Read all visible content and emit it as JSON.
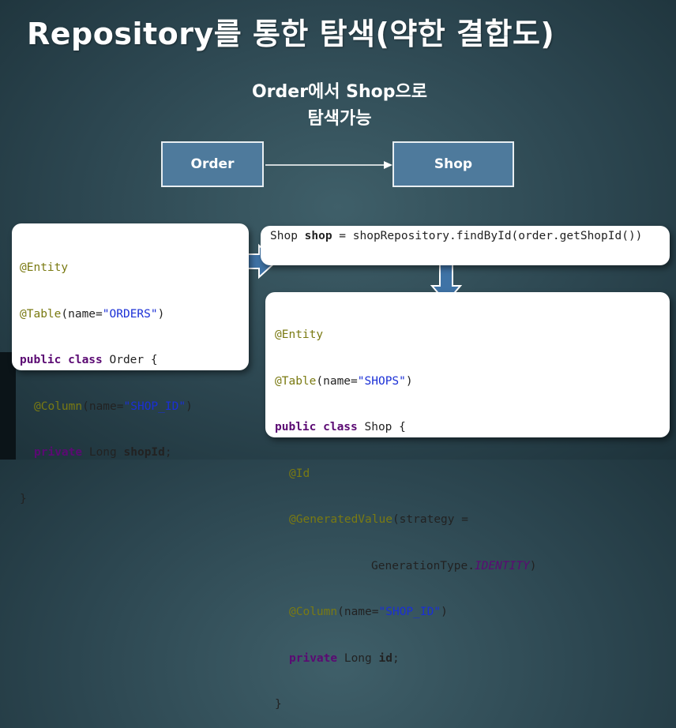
{
  "title": "Repository를 통한 탐색(약한 결합도)",
  "caption": {
    "line1": "Order에서 Shop으로",
    "line2": "탐색가능"
  },
  "boxes": {
    "order": "Order",
    "shop": "Shop"
  },
  "code_order": {
    "l1_ann": "@Entity",
    "l2_ann": "@Table",
    "l2_a": "(name=",
    "l2_str": "\"ORDERS\"",
    "l2_b": ")",
    "l3_kw": "public class",
    "l3_rest": " Order {",
    "l4_ann": "@Column",
    "l4_a": "(name=",
    "l4_str": "\"SHOP_ID\"",
    "l4_b": ")",
    "l5_kw": "private",
    "l5_a": " Long ",
    "l5_bold": "shopId",
    "l5_b": ";",
    "l6": "}"
  },
  "code_lookup": {
    "a": "Shop ",
    "bold": "shop",
    "b": " = shopRepository.findById(order.getShopId())"
  },
  "code_shop": {
    "l1_ann": "@Entity",
    "l2_ann": "@Table",
    "l2_a": "(name=",
    "l2_str": "\"SHOPS\"",
    "l2_b": ")",
    "l3_kw": "public class",
    "l3_rest": " Shop {",
    "l4_ann": "@Id",
    "l5_ann": "@GeneratedValue",
    "l5_a": "(strategy =",
    "l6_a": "GenerationType.",
    "l6_italic": "IDENTITY",
    "l6_b": ")",
    "l7_ann": "@Column",
    "l7_a": "(name=",
    "l7_str": "\"SHOP_ID\"",
    "l7_b": ")",
    "l8_kw": "private",
    "l8_a": " Long ",
    "l8_bold": "id",
    "l8_b": ";",
    "l9": "}"
  },
  "colors": {
    "background": "#2c4650",
    "entity_box": "#4e7a9c",
    "arrow": "#3f73a6",
    "annotation": "#7a7a12",
    "keyword": "#5b0a73",
    "string": "#1a2fd6"
  }
}
